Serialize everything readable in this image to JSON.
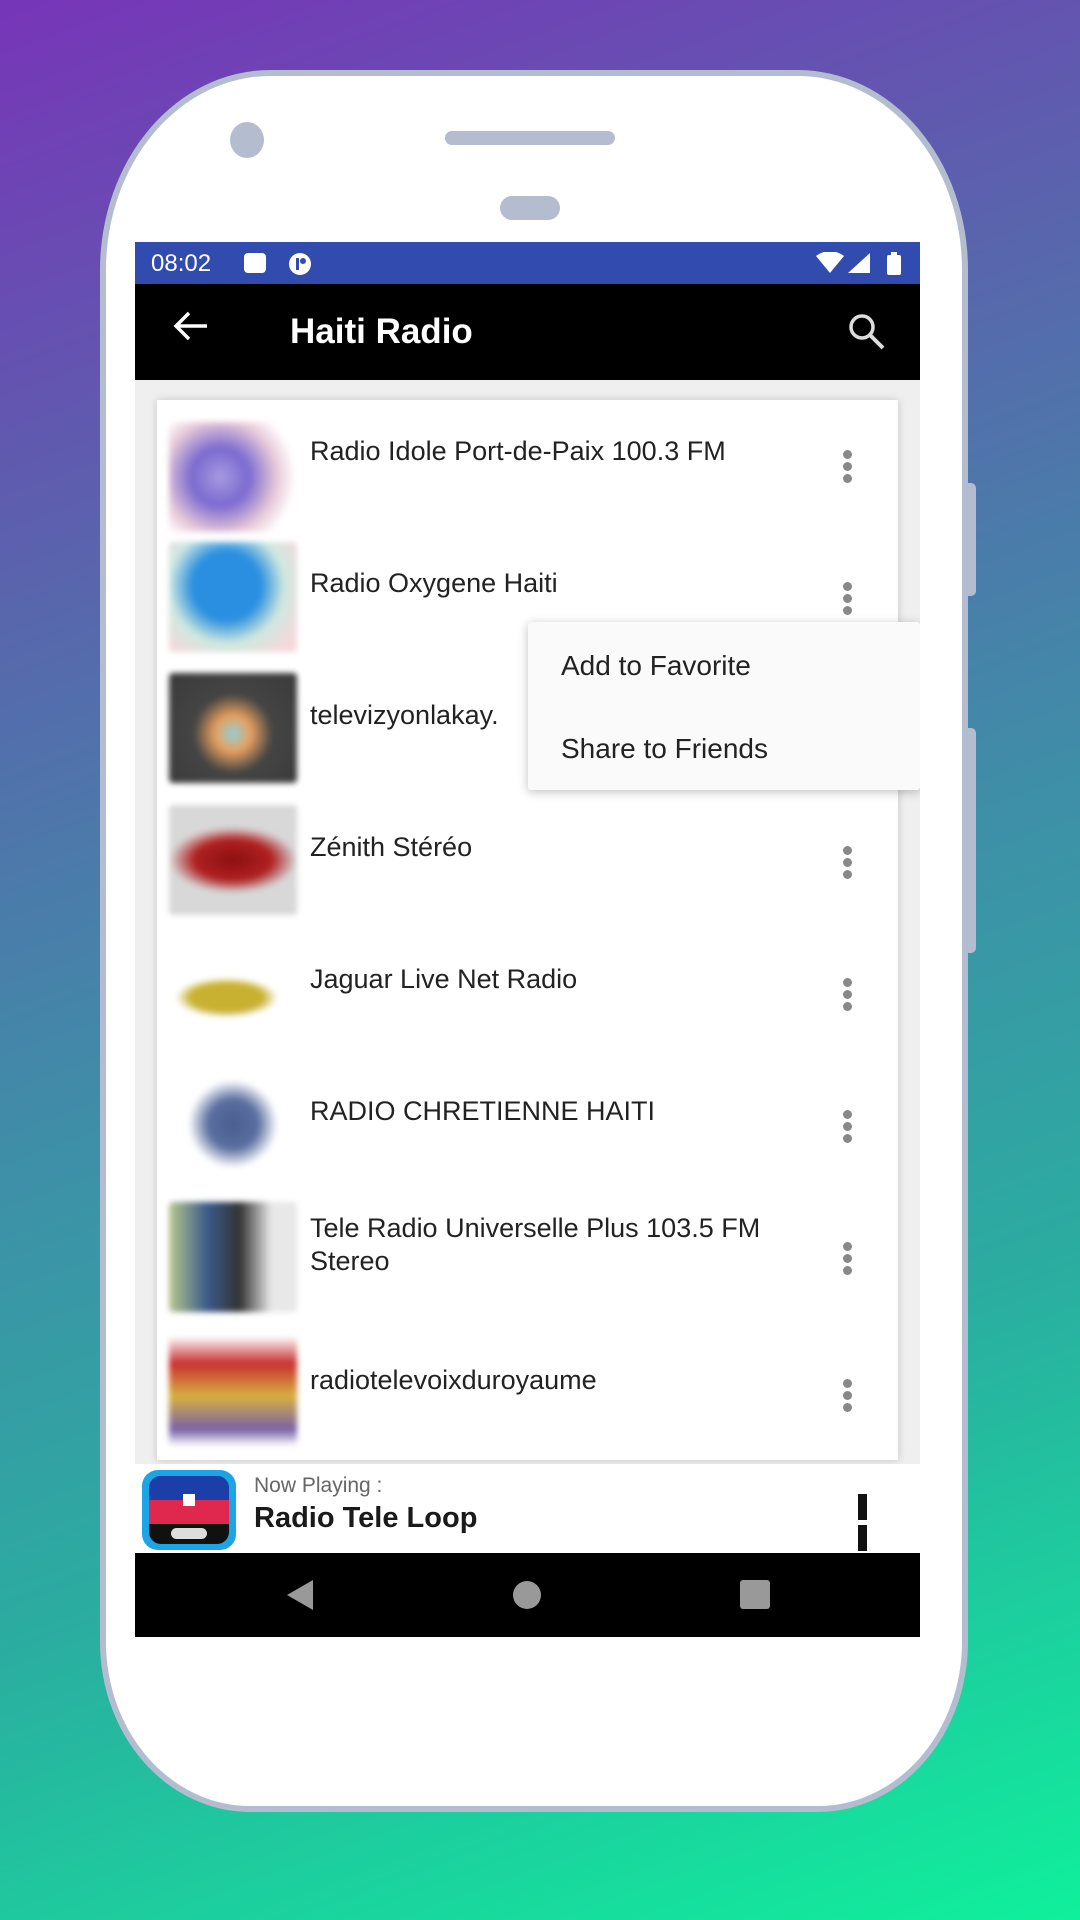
{
  "status_bar": {
    "time": "08:02",
    "icons": [
      "sd-card-icon",
      "notification-app-icon",
      "wifi-icon",
      "signal-icon",
      "battery-icon"
    ]
  },
  "toolbar": {
    "back_icon": "arrow-left-icon",
    "title": "Haiti Radio",
    "search_icon": "search-icon"
  },
  "stations": [
    {
      "name": "Radio Idole Port-de-Paix 100.3 FM"
    },
    {
      "name": "Radio Oxygene Haiti"
    },
    {
      "name": "televizyonlakay."
    },
    {
      "name": "Zénith Stéréo"
    },
    {
      "name": "Jaguar Live Net Radio"
    },
    {
      "name": "RADIO CHRETIENNE HAITI"
    },
    {
      "name": "Tele Radio Universelle Plus 103.5 FM Stereo"
    },
    {
      "name": "radiotelevoixduroyaume"
    }
  ],
  "context_menu": {
    "items": [
      "Add to Favorite",
      "Share to Friends"
    ]
  },
  "now_playing": {
    "label": "Now Playing :",
    "station": "Radio Tele Loop",
    "control": "pause-icon"
  },
  "colors": {
    "status_bar": "#324bae",
    "toolbar": "#000000",
    "accent_icon_border": "#1ca4e4"
  }
}
